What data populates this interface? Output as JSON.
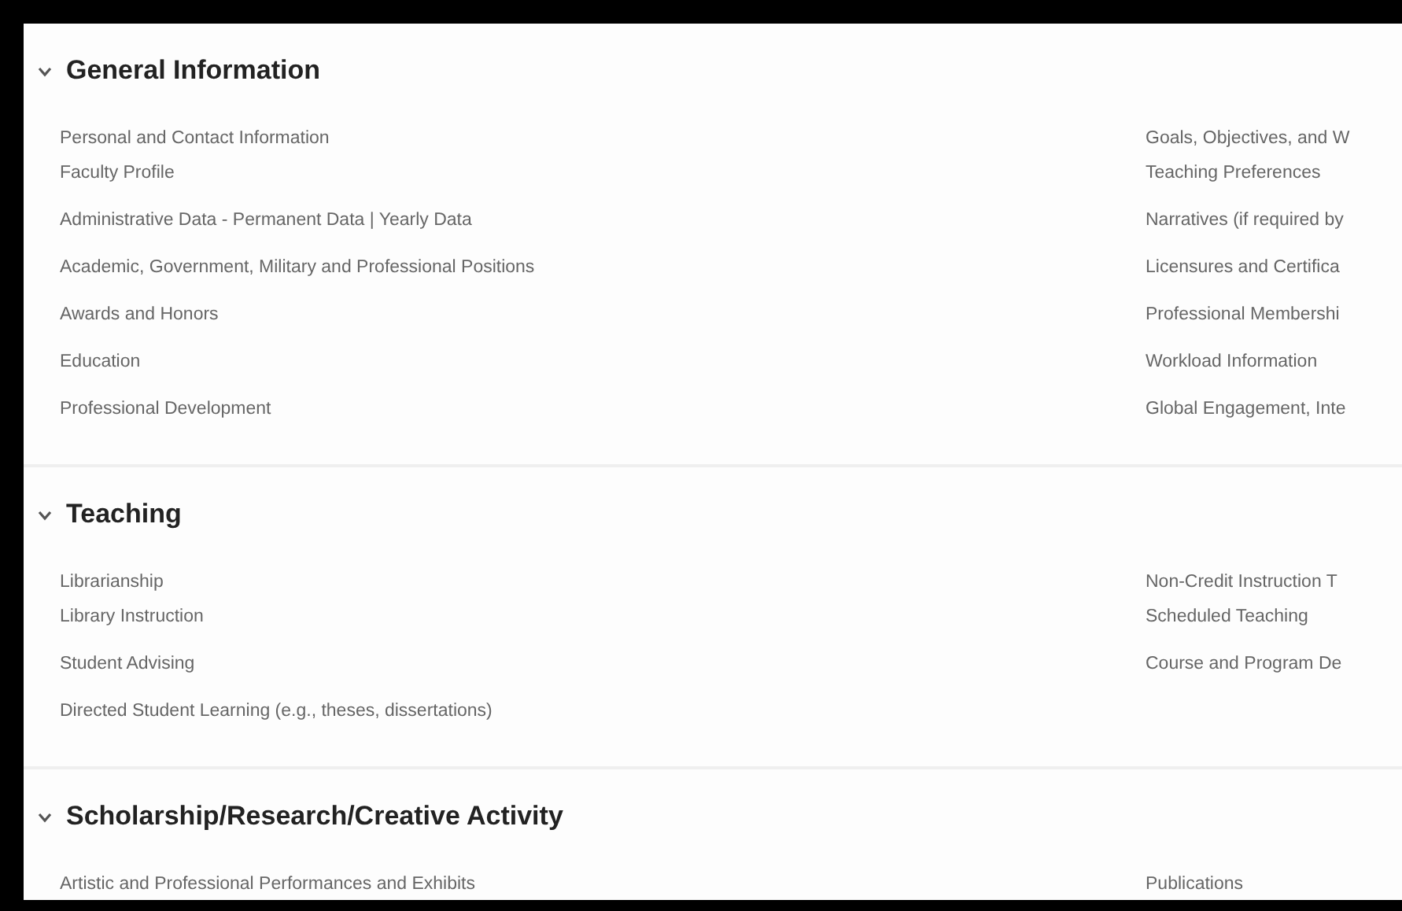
{
  "sections": [
    {
      "title": "General Information",
      "expanded": true,
      "columns": [
        [
          [
            "Personal and Contact Information",
            "Faculty Profile"
          ],
          [
            "Administrative Data - Permanent Data | Yearly Data"
          ],
          [
            "Academic, Government, Military and Professional Positions"
          ],
          [
            "Awards and Honors"
          ],
          [
            "Education"
          ],
          [
            "Professional Development"
          ]
        ],
        [
          [
            "Goals, Objectives, and W",
            "Teaching Preferences"
          ],
          [
            "Narratives (if required by"
          ],
          [
            "Licensures and Certifica"
          ],
          [
            "Professional Membershi"
          ],
          [
            "Workload Information"
          ],
          [
            "Global Engagement, Inte"
          ]
        ]
      ]
    },
    {
      "title": "Teaching",
      "expanded": true,
      "columns": [
        [
          [
            "Librarianship",
            "Library Instruction"
          ],
          [
            "Student Advising"
          ],
          [
            "Directed Student Learning (e.g., theses, dissertations)"
          ]
        ],
        [
          [
            "Non-Credit Instruction T",
            "Scheduled Teaching"
          ],
          [
            "Course and Program De"
          ]
        ]
      ]
    },
    {
      "title": "Scholarship/Research/Creative Activity",
      "expanded": true,
      "columns": [
        [
          [
            "Artistic and Professional Performances and Exhibits"
          ]
        ],
        [
          [
            "Publications"
          ]
        ]
      ]
    }
  ]
}
